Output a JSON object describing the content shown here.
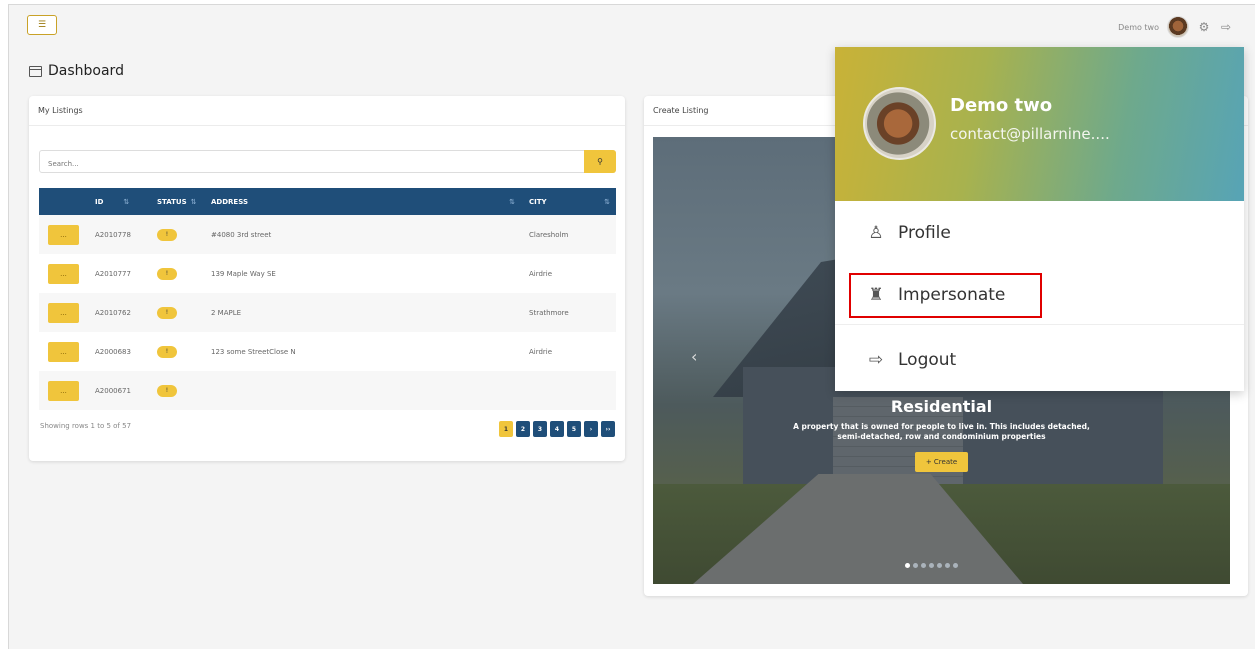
{
  "topbar": {
    "menu_toggle_icon": "menu-toggle-icon",
    "user_name": "Demo two",
    "settings_icon": "gear-icon",
    "logout_icon": "logout-icon"
  },
  "page": {
    "title": "Dashboard"
  },
  "listings": {
    "header": "My Listings",
    "search_placeholder": "Search...",
    "columns": [
      "ID",
      "STATUS",
      "ADDRESS",
      "CITY"
    ],
    "rows": [
      {
        "id": "A2010778",
        "status": "!",
        "address": "#4080 3rd street",
        "city": "Claresholm"
      },
      {
        "id": "A2010777",
        "status": "!",
        "address": "139 Maple Way SE",
        "city": "Airdrie"
      },
      {
        "id": "A2010762",
        "status": "!",
        "address": "2 MAPLE",
        "city": "Strathmore"
      },
      {
        "id": "A2000683",
        "status": "!",
        "address": "123 some StreetClose N",
        "city": "Airdrie"
      },
      {
        "id": "A2000671",
        "status": "!",
        "address": "",
        "city": ""
      }
    ],
    "row_button_label": "...",
    "showing": "Showing rows 1 to 5 of 57",
    "pages": [
      "1",
      "2",
      "3",
      "4",
      "5",
      "›",
      "››"
    ],
    "active_page": "1"
  },
  "create": {
    "header": "Create Listing",
    "slide_title": "Residential",
    "slide_desc_line1": "A property that is owned for people to live in. This includes detached,",
    "slide_desc_line2": "semi-detached, row and condominium properties",
    "create_label": "+ Create",
    "prev_icon": "‹",
    "slide_count": 7,
    "active_slide": 1
  },
  "dropdown": {
    "name": "Demo two",
    "email": "contact@pillarnine....",
    "profile_label": "Profile",
    "impersonate_label": "Impersonate",
    "logout_label": "Logout"
  },
  "colors": {
    "accent_yellow": "#f0c53c",
    "table_header": "#1f4e79",
    "highlight": "#e00000"
  }
}
